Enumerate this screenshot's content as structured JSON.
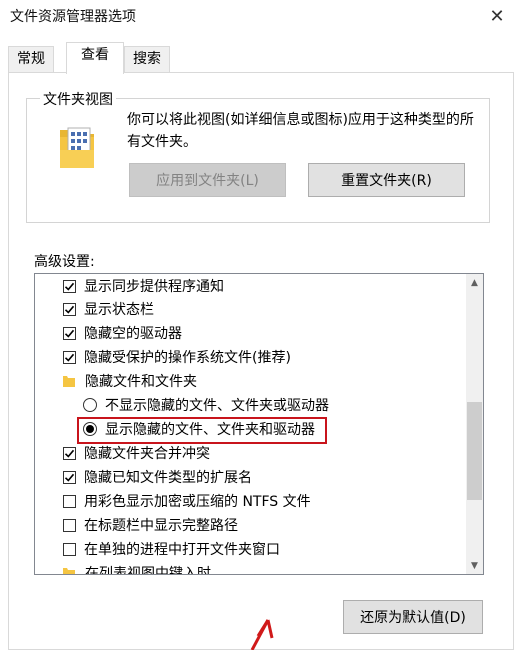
{
  "window": {
    "title": "文件资源管理器选项",
    "close_glyph": "✕"
  },
  "tabs": [
    {
      "label": "常规",
      "active": false
    },
    {
      "label": "查看",
      "active": true
    },
    {
      "label": "搜索",
      "active": false
    }
  ],
  "folder_views": {
    "legend": "文件夹视图",
    "description": "你可以将此视图(如详细信息或图标)应用于这种类型的所有文件夹。",
    "apply_button": "应用到文件夹(L)",
    "reset_button": "重置文件夹(R)"
  },
  "advanced": {
    "label": "高级设置:",
    "items": [
      {
        "type": "checkbox",
        "checked": true,
        "label": "显示同步提供程序通知"
      },
      {
        "type": "checkbox",
        "checked": true,
        "label": "显示状态栏"
      },
      {
        "type": "checkbox",
        "checked": true,
        "label": "隐藏空的驱动器"
      },
      {
        "type": "checkbox",
        "checked": true,
        "label": "隐藏受保护的操作系统文件(推荐)"
      },
      {
        "type": "folder",
        "label": "隐藏文件和文件夹"
      },
      {
        "type": "radio",
        "checked": false,
        "label": "不显示隐藏的文件、文件夹或驱动器"
      },
      {
        "type": "radio",
        "checked": true,
        "label": "显示隐藏的文件、文件夹和驱动器"
      },
      {
        "type": "checkbox",
        "checked": true,
        "label": "隐藏文件夹合并冲突"
      },
      {
        "type": "checkbox",
        "checked": true,
        "label": "隐藏已知文件类型的扩展名"
      },
      {
        "type": "checkbox",
        "checked": false,
        "label": "用彩色显示加密或压缩的 NTFS 文件"
      },
      {
        "type": "checkbox",
        "checked": false,
        "label": "在标题栏中显示完整路径"
      },
      {
        "type": "checkbox",
        "checked": false,
        "label": "在单独的进程中打开文件夹窗口"
      },
      {
        "type": "folder",
        "label": "在列表视图中键入时"
      }
    ],
    "restore_button": "还原为默认值(D)"
  },
  "colors": {
    "highlight": "#c8141c",
    "folder": "#f5c542"
  }
}
